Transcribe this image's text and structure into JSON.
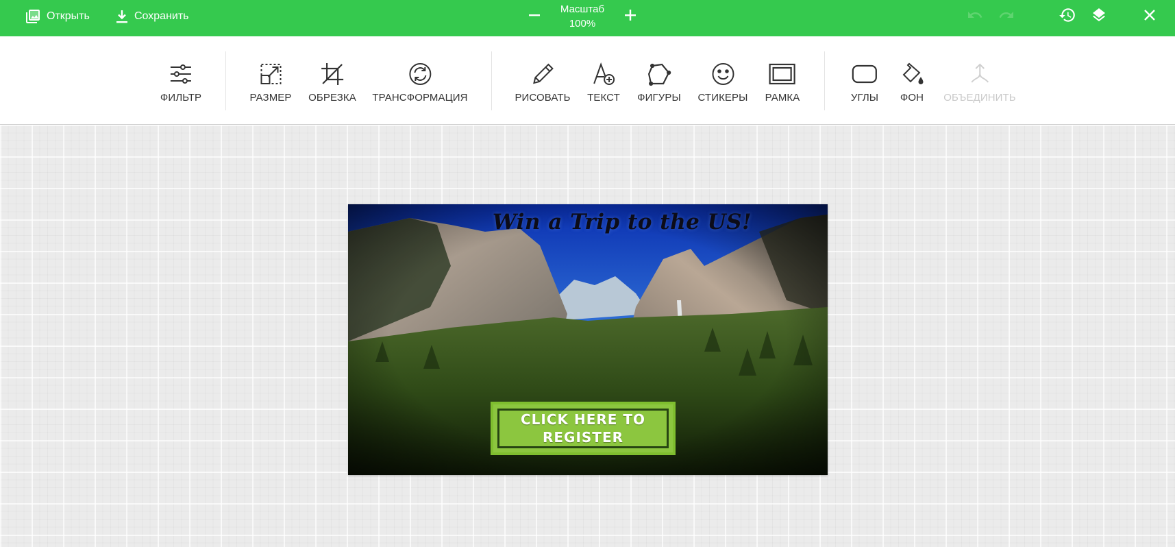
{
  "topbar": {
    "open_label": "Открыть",
    "save_label": "Сохранить",
    "zoom_label": "Масштаб",
    "zoom_value": "100%",
    "bg_color": "#35c94e"
  },
  "tools": {
    "filter": "ФИЛЬТР",
    "resize": "РАЗМЕР",
    "crop": "ОБРЕЗКА",
    "transform": "ТРАНСФОРМАЦИЯ",
    "draw": "РИСОВАТЬ",
    "text": "ТЕКСТ",
    "shapes": "ФИГУРЫ",
    "stickers": "СТИКЕРЫ",
    "frame": "РАМКА",
    "corners": "УГЛЫ",
    "background": "ФОН",
    "merge": "ОБЪЕДИНИТЬ"
  },
  "canvas": {
    "title": "Win a Trip to the US!",
    "cta": "CLICK HERE TO REGISTER",
    "cta_color": "#8cc63f"
  },
  "icons": {
    "open": "image-icon",
    "save": "download-icon",
    "zoom_out": "minus-icon",
    "zoom_in": "plus-icon",
    "undo": "undo-icon",
    "redo": "redo-icon",
    "history": "history-icon",
    "layers": "layers-icon",
    "close": "close-icon"
  }
}
